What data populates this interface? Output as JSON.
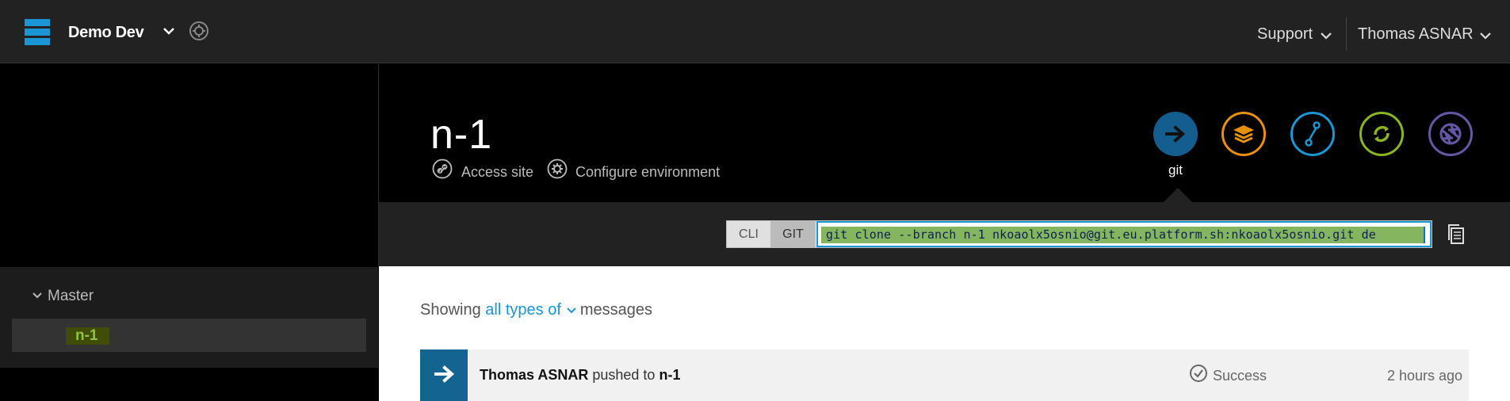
{
  "topbar": {
    "project_name": "Demo Dev",
    "support_label": "Support",
    "user_name": "Thomas ASNAR"
  },
  "sidebar": {
    "tree_root": "Master",
    "selected_env": "n-1"
  },
  "environment": {
    "title": "n-1",
    "access_site_label": "Access site",
    "configure_label": "Configure environment"
  },
  "actions": [
    {
      "name": "git",
      "label": "git",
      "icon": "arrow-right-icon",
      "color": "#135d8f"
    },
    {
      "name": "merge",
      "icon": "layers-icon",
      "color": "#e6900f"
    },
    {
      "name": "branch",
      "icon": "branch-icon",
      "color": "#1a96d4"
    },
    {
      "name": "sync",
      "icon": "sync-icon",
      "color": "#8ab521"
    },
    {
      "name": "backup",
      "icon": "aperture-icon",
      "color": "#6657a6"
    }
  ],
  "command": {
    "cli_label": "CLI",
    "git_label": "GIT",
    "git_command": "git clone --branch n-1 nkoaolx5osnio@git.eu.platform.sh:nkoaolx5osnio.git de"
  },
  "activity": {
    "filter_prefix": "Showing",
    "filter_link": "all types of",
    "filter_suffix": "messages",
    "items": [
      {
        "user": "Thomas ASNAR",
        "action": "pushed to",
        "target": "n-1",
        "status": "Success",
        "time": "2 hours ago"
      }
    ]
  },
  "colors": {
    "accent": "#1a96d4",
    "topbar_bg": "#222222",
    "success_green": "#8ec63f"
  }
}
